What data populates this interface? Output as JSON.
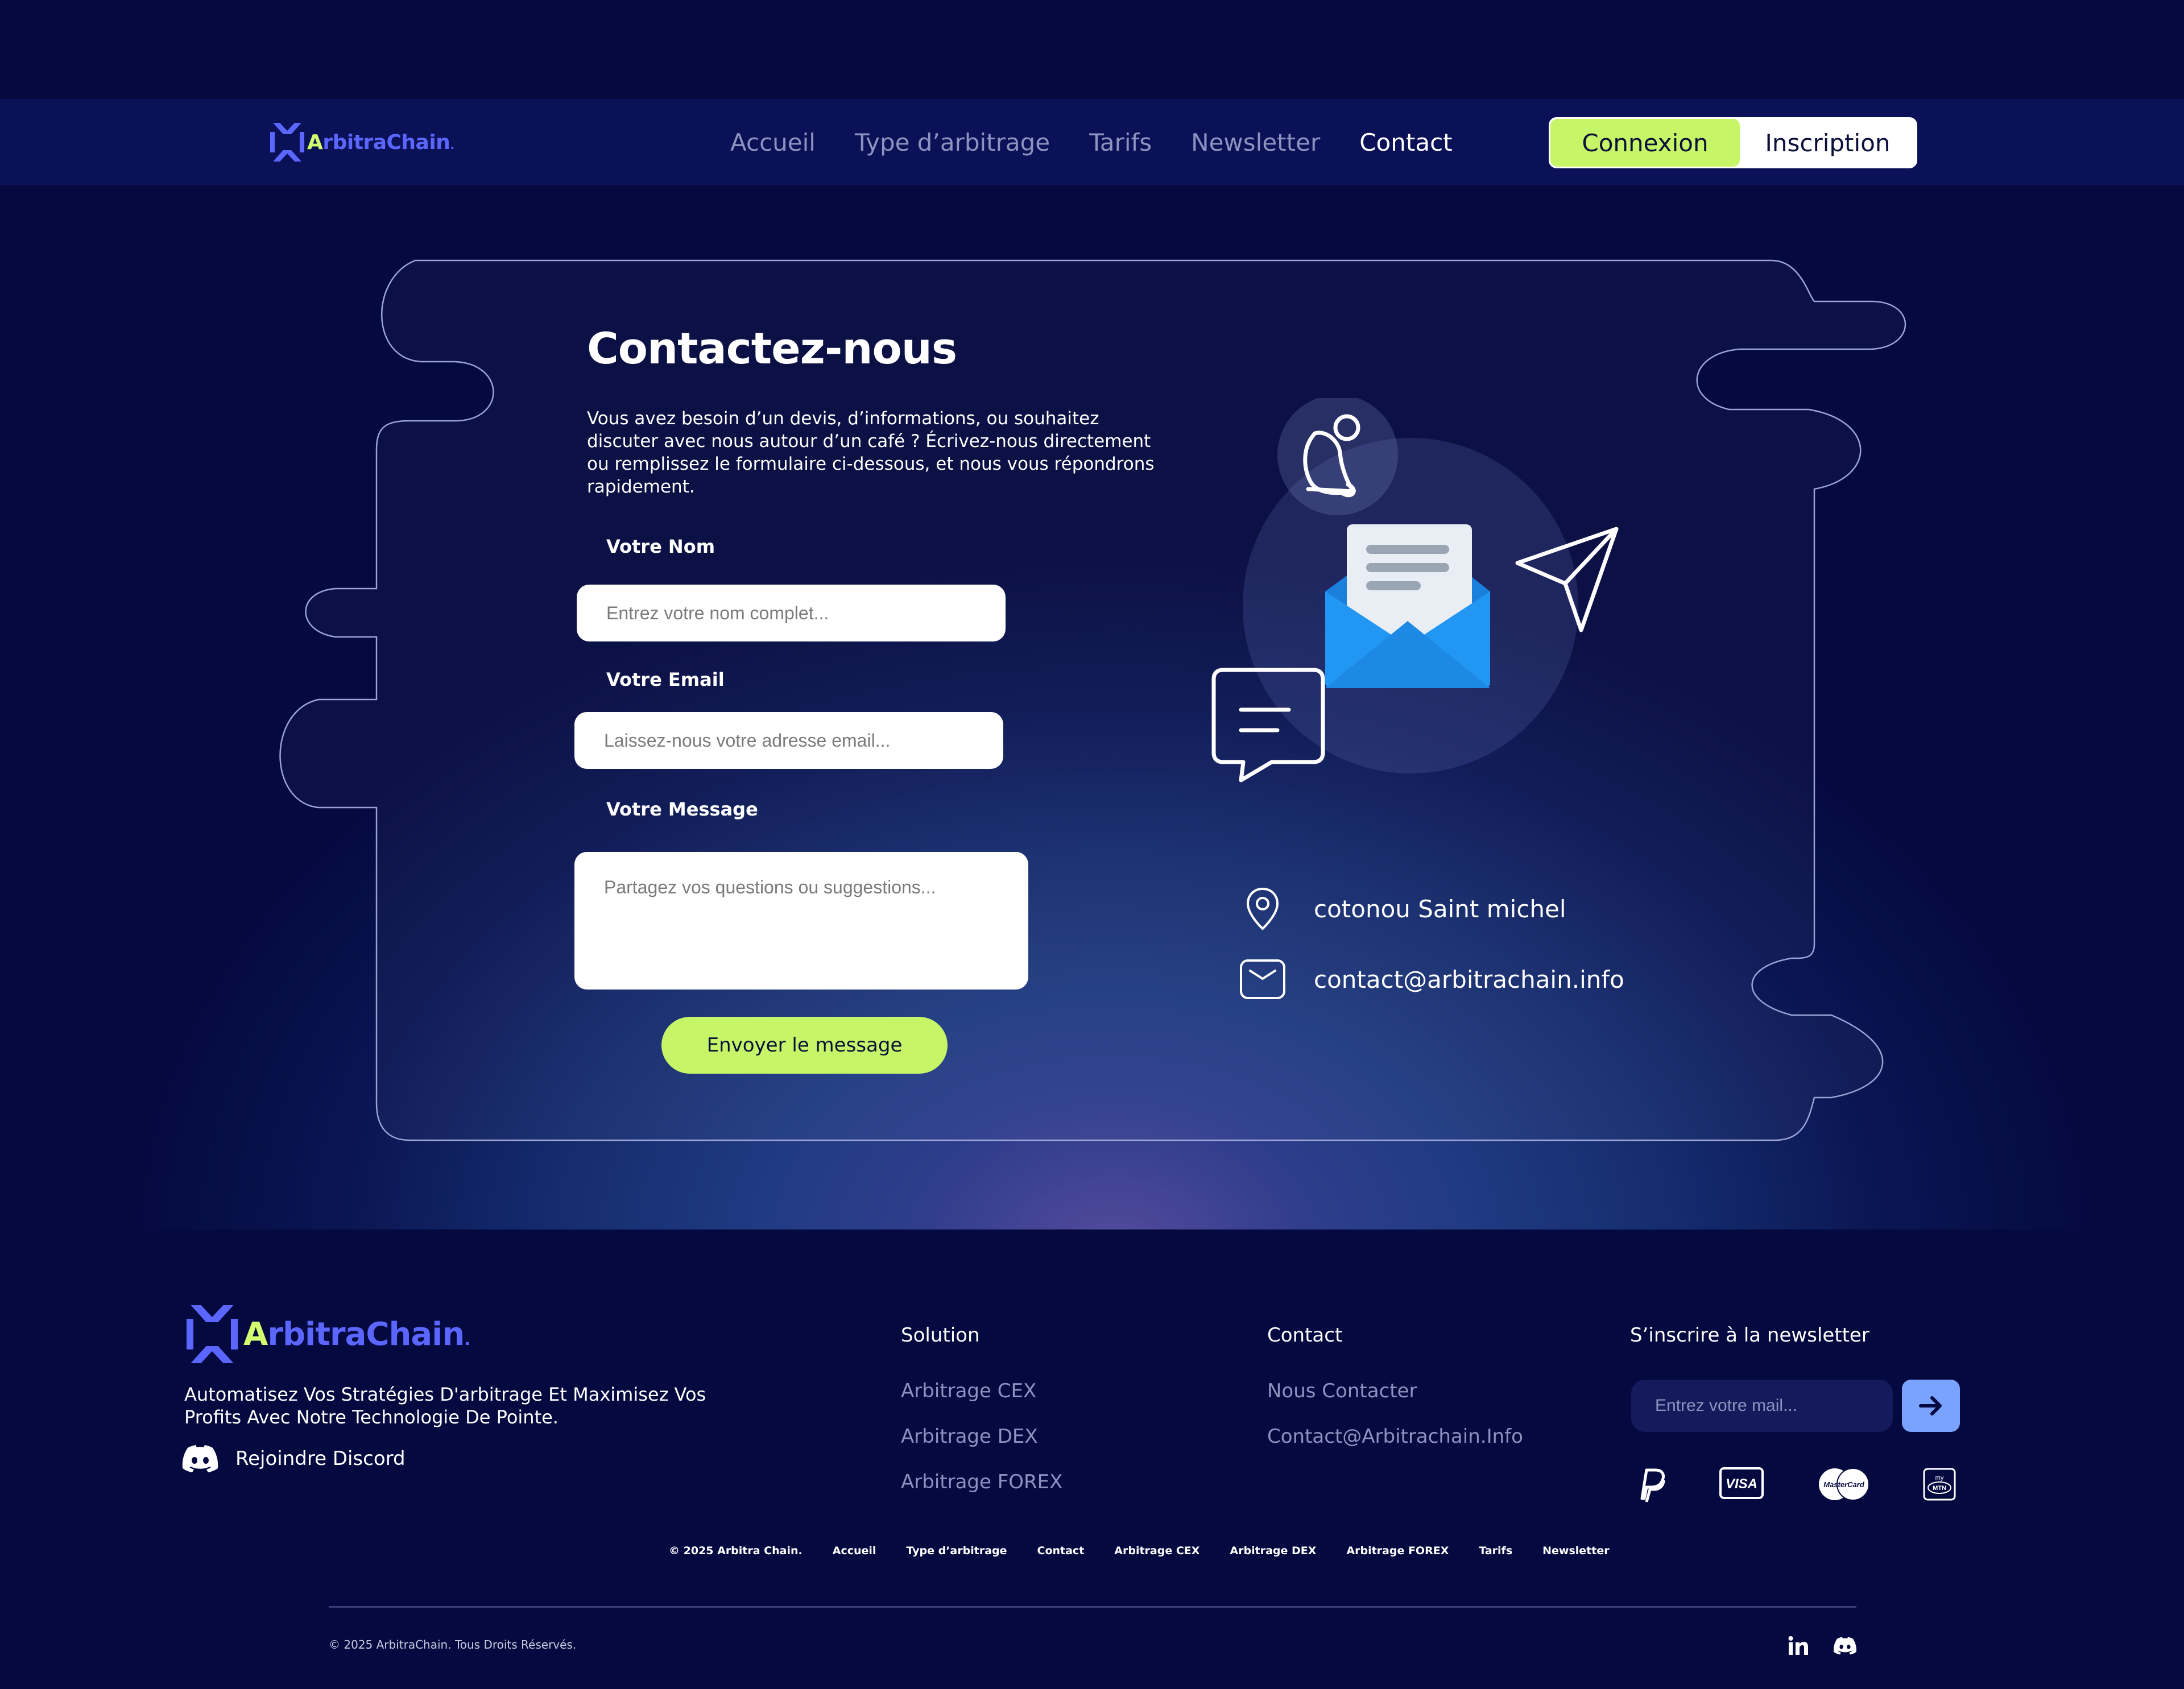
{
  "nav": {
    "logo": {
      "first_letter": "A",
      "rest": "rbitraChain",
      "dot": "."
    },
    "links": [
      "Accueil",
      "Type d’arbitrage",
      "Tarifs",
      "Newsletter",
      "Contact"
    ],
    "active_link": "Contact",
    "login_label": "Connexion",
    "signup_label": "Inscription"
  },
  "contact": {
    "title": "Contactez-nous",
    "description": "Vous avez besoin d’un devis, d’informations, ou souhaitez discuter avec nous autour d’un café ? Écrivez-nous directement ou remplissez le formulaire ci-dessous, et nous vous répondrons rapidement.",
    "name_label": "Votre Nom",
    "name_placeholder": "Entrez votre nom complet...",
    "email_label": "Votre Email",
    "email_placeholder": "Laissez-nous votre adresse email...",
    "message_label": "Votre Message",
    "message_placeholder": "Partagez vos questions ou suggestions...",
    "send_label": "Envoyer le message",
    "address": "cotonou  Saint michel",
    "email": "contact@arbitrachain.info"
  },
  "footer": {
    "logo": {
      "first_letter": "A",
      "rest": "rbitraChain",
      "dot": "."
    },
    "tagline": "Automatisez Vos Stratégies D'arbitrage Et Maximisez Vos Profits Avec Notre Technologie De Pointe.",
    "discord_label": "Rejoindre Discord",
    "solution": {
      "title": "Solution",
      "links": [
        "Arbitrage CEX",
        "Arbitrage DEX",
        "Arbitrage FOREX"
      ]
    },
    "contact": {
      "title": "Contact",
      "links": [
        "Nous Contacter",
        "Contact@Arbitrachain.Info"
      ]
    },
    "newsletter": {
      "title": "S’inscrire à la newsletter",
      "placeholder": "Entrez votre mail..."
    },
    "payment_icons": [
      "paypal-icon",
      "visa-icon",
      "mastercard-icon",
      "mtn-momo-icon"
    ],
    "payment_texts": {
      "visa": "VISA",
      "mastercard": "MasterCard",
      "momo_top": "my",
      "momo_bottom": "MTN"
    },
    "bottom_links": [
      "© 2025 Arbitra Chain.",
      "Accueil",
      "Type d’arbitrage",
      "Contact",
      "Arbitrage CEX",
      "Arbitrage DEX",
      "Arbitrage FOREX",
      "Tarifs",
      "Newsletter"
    ],
    "copyright": "© 2025 ArbitraChain. Tous Droits Réservés.",
    "social_icons": [
      "linkedin-icon",
      "discord-icon"
    ]
  },
  "colors": {
    "background": "#04093f",
    "navbar": "#0a1157",
    "accent_green": "#c6f667",
    "brand_blue": "#5b66ff",
    "newsletter_button": "#7aa3ff",
    "envelope_blue": "#2196f3"
  }
}
